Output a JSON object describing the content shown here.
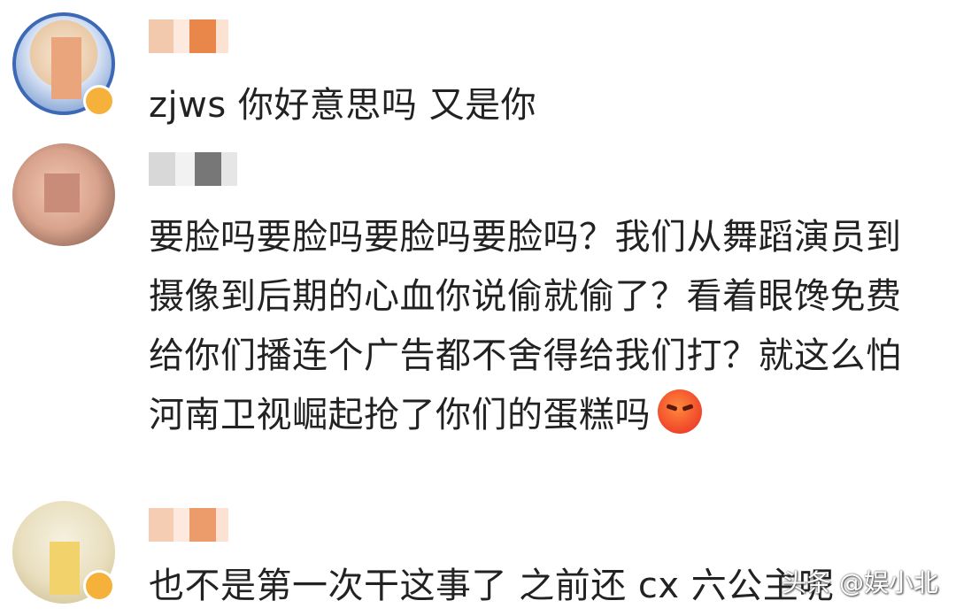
{
  "comments": [
    {
      "text": "zjws 你好意思吗 又是你"
    },
    {
      "text": "要脸吗要脸吗要脸吗要脸吗？我们从舞蹈演员到摄像到后期的心血你说偷就偷了？看着眼馋免费给你们播连个广告都不舍得给我们打？就这么怕河南卫视崛起抢了你们的蛋糕吗",
      "emoji": "angry-face-emoji"
    },
    {
      "text": "也不是第一次干这事了 之前还 cx 六公主呢"
    }
  ],
  "watermark": "头条 @娱小北"
}
